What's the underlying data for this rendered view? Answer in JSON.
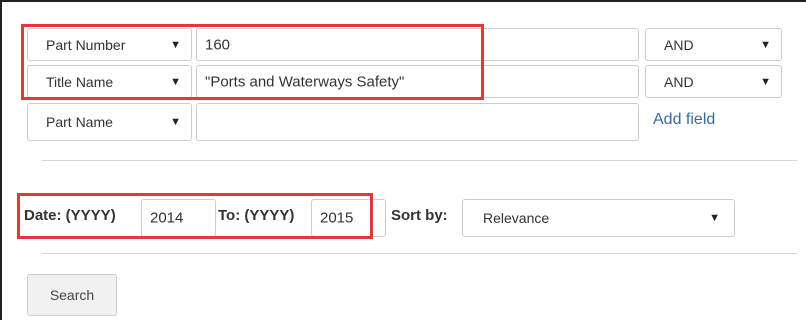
{
  "rows": [
    {
      "field": "Part Number",
      "value": "160",
      "operator": "AND"
    },
    {
      "field": "Title Name",
      "value": "\"Ports and Waterways Safety\"",
      "operator": "AND"
    },
    {
      "field": "Part Name",
      "value": ""
    }
  ],
  "add_field": "Add field",
  "date": {
    "from_label": "Date: (YYYY)",
    "from_value": "2014",
    "to_label": "To: (YYYY)",
    "to_value": "2015"
  },
  "sort": {
    "label": "Sort by:",
    "value": "Relevance"
  },
  "search_button": "Search",
  "icons": {
    "dropdown": "triangle-down-icon",
    "glyph": "▼"
  },
  "colors": {
    "highlight": "#e4393c",
    "link": "#3b6aa0"
  }
}
